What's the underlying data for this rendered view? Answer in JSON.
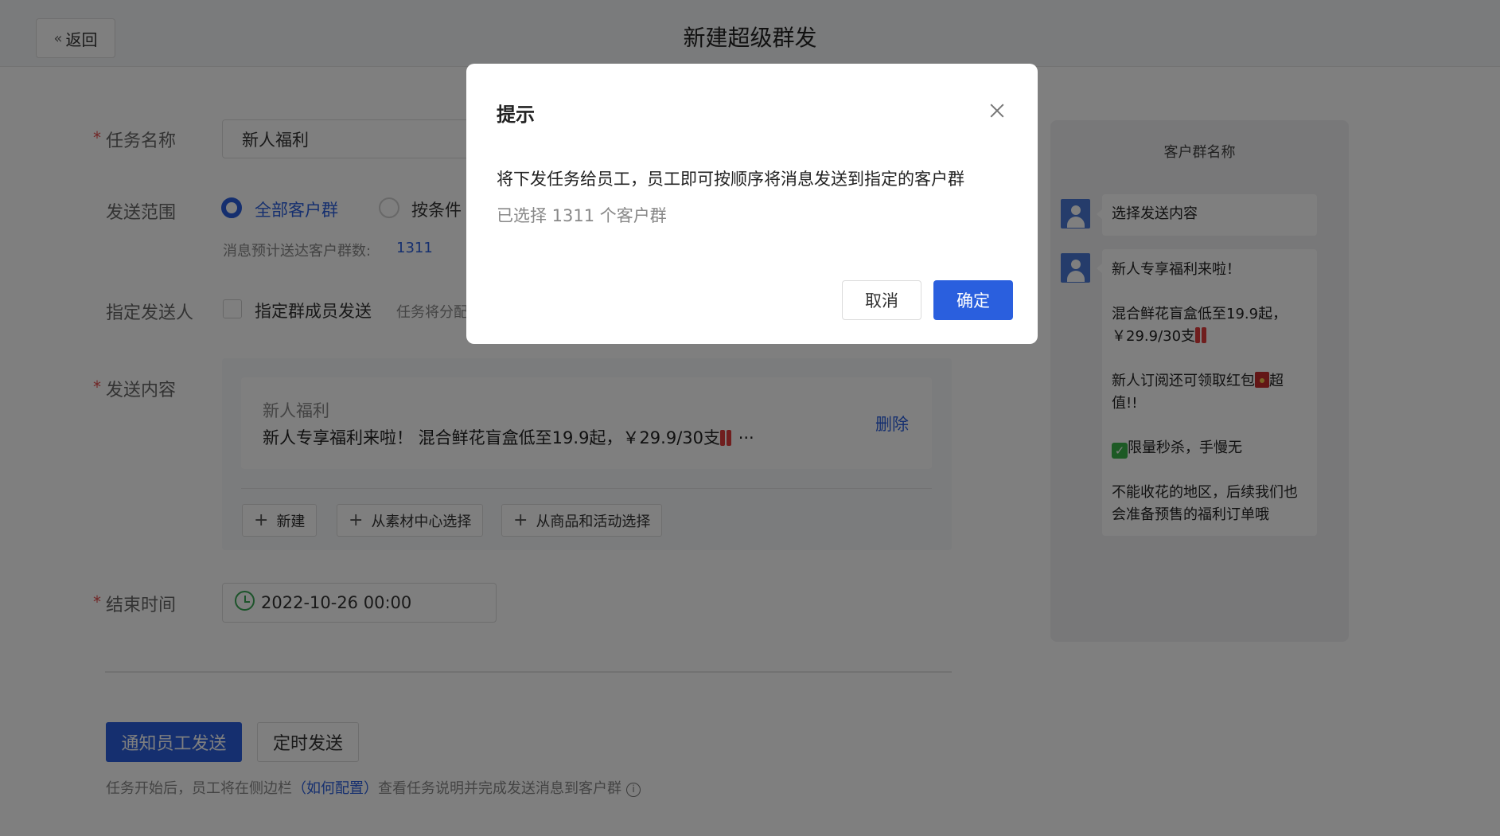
{
  "header": {
    "back_label": "返回",
    "title": "新建超级群发"
  },
  "form": {
    "task_name": {
      "label": "任务名称",
      "value": "新人福利"
    },
    "scope": {
      "label": "发送范围",
      "option_all": "全部客户群",
      "option_cond": "按条件",
      "estimate_label": "消息预计送达客户群数:",
      "estimate_value": "1311"
    },
    "sender": {
      "label": "指定发送人",
      "checkbox_label": "指定群成员发送",
      "hint": "任务将分配"
    },
    "content": {
      "label": "发送内容",
      "message_title": "新人福利",
      "message_body": "新人专享福利来啦！ 混合鲜花盲盒低至19.9起，￥29.9/30支",
      "ellipsis": "···",
      "delete_label": "删除",
      "btn_new": "新建",
      "btn_material": "从素材中心选择",
      "btn_product": "从商品和活动选择"
    },
    "end_time": {
      "label": "结束时间",
      "value": "2022-10-26 00:00"
    }
  },
  "actions": {
    "notify_label": "通知员工发送",
    "schedule_label": "定时发送",
    "note_before": "任务开始后，员工将在侧边栏",
    "note_link": "（如何配置）",
    "note_after": "查看任务说明并完成发送消息到客户群",
    "info_glyph": "i"
  },
  "preview": {
    "title": "客户群名称",
    "bubble1": "选择发送内容",
    "p1": "新人专享福利来啦！",
    "p2a": "混合鲜花盲盒低至19.9起，",
    "p2b": "￥29.9/30支",
    "p3a": "新人订阅还可领取红包",
    "p3b": "超值!!",
    "p4": "限量秒杀，手慢无",
    "p5": "不能收花的地区，后续我们也会准备预售的福利订单哦",
    "check_glyph": "✓"
  },
  "modal": {
    "title": "提示",
    "text": "将下发任务给员工，员工即可按顺序将消息发送到指定的客户群",
    "selected": "已选择 1311 个客户群",
    "cancel_label": "取消",
    "ok_label": "确定"
  },
  "colors": {
    "accent": "#2a5fde",
    "required": "#e34d4d",
    "clock": "#3aa856",
    "overlay": "rgba(0,0,0,0.5)"
  }
}
